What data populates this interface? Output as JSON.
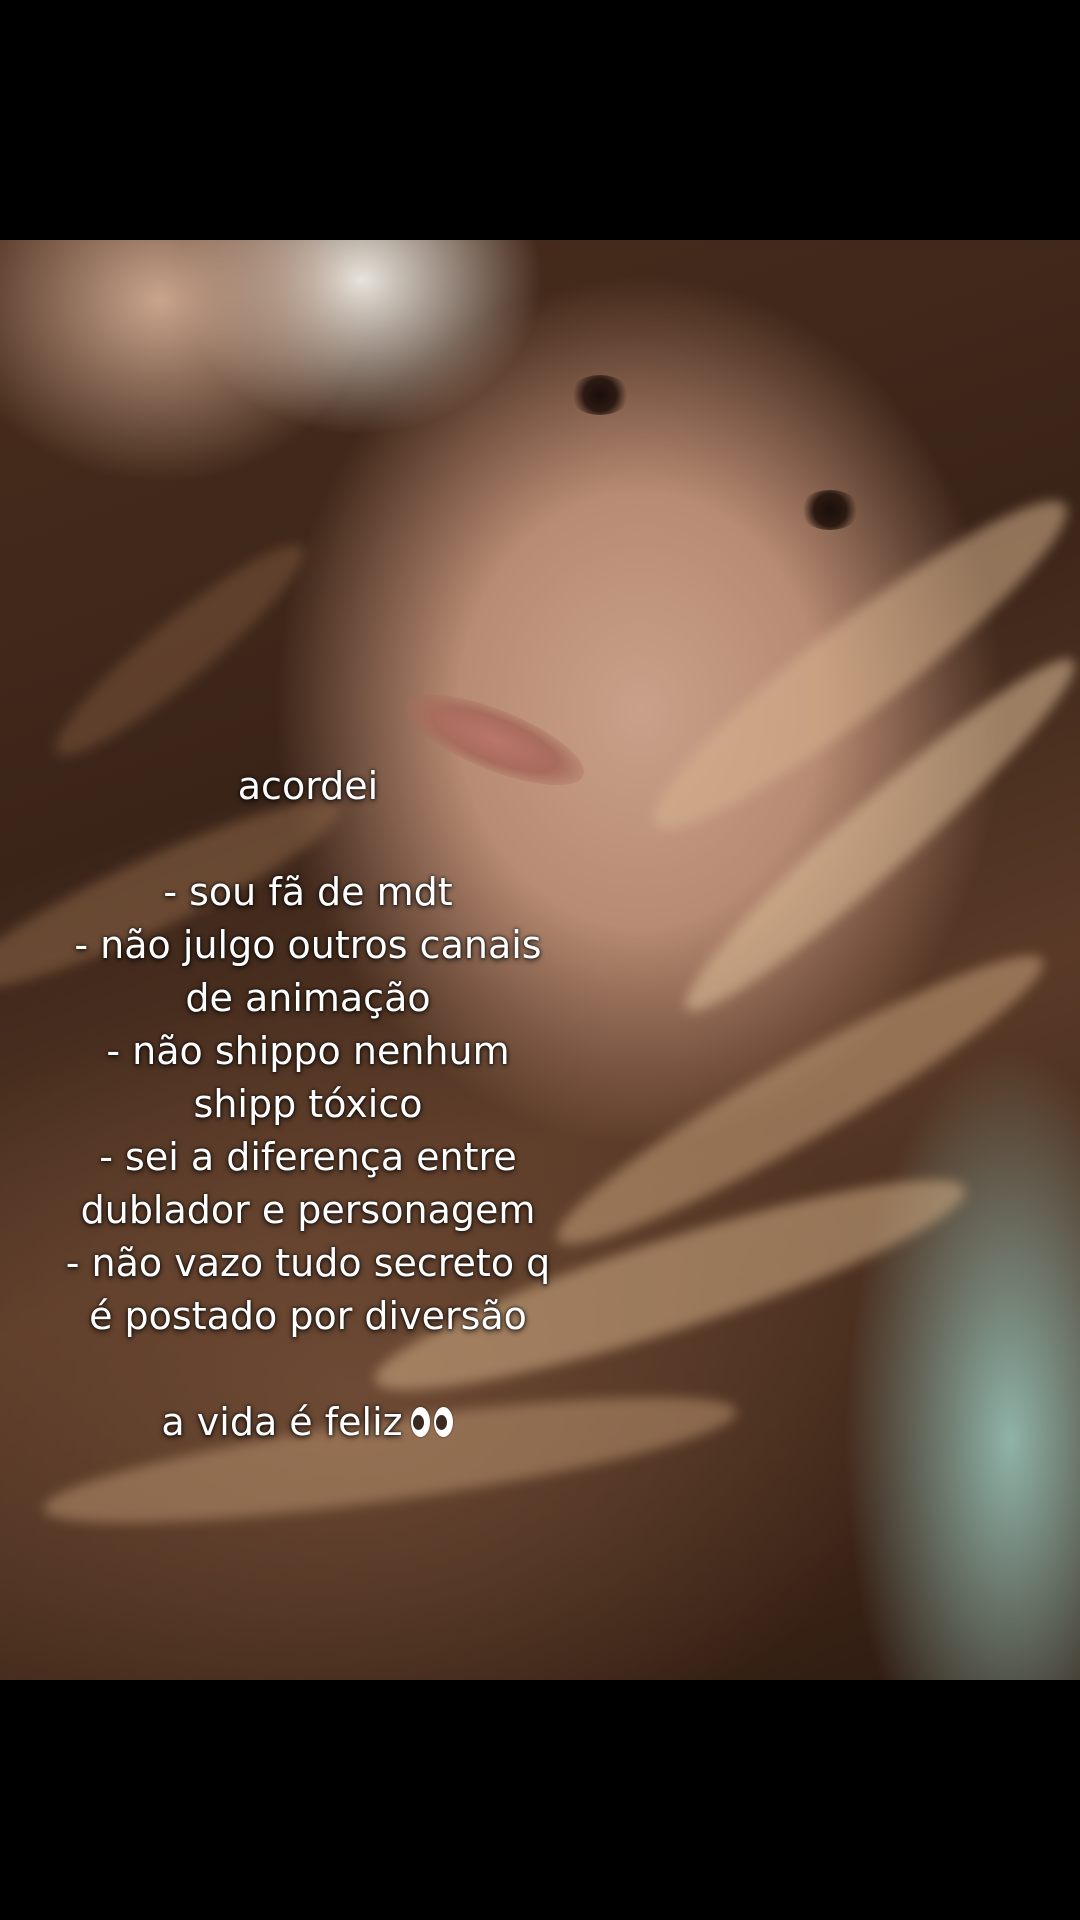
{
  "caption": {
    "title": "acordei",
    "items": [
      "- sou fã de mdt",
      "- não julgo outros canais",
      "de animação",
      "- não shippo nenhum",
      "shipp tóxico",
      "- sei a diferença entre",
      "dublador e personagem",
      "- não vazo tudo secreto q",
      "é postado por diversão"
    ],
    "closing": "a vida é feliz",
    "closing_emoji": "eyes-emoji"
  },
  "colors": {
    "background": "#000000",
    "caption_text": "#ffffff"
  }
}
